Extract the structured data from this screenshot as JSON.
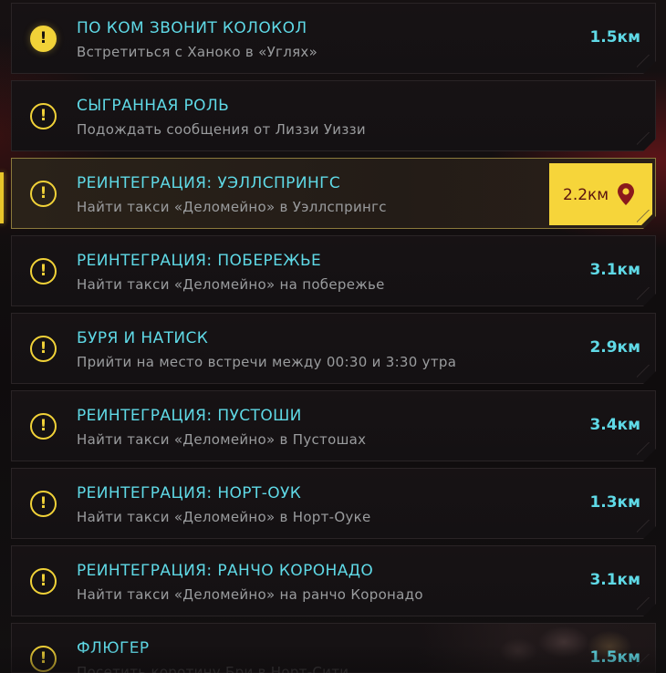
{
  "jobs": [
    {
      "title": "ПО КОМ ЗВОНИТ КОЛОКОЛ",
      "subtitle": "Встретиться с Ханоко в «Углях»",
      "distance": "1.5км",
      "icon": "exclamation-filled-icon"
    },
    {
      "title": "СЫГРАННАЯ РОЛЬ",
      "subtitle": "Подождать сообщения от Лиззи Уиззи",
      "distance": "",
      "icon": "exclamation-icon"
    },
    {
      "title": "РЕИНТЕГРАЦИЯ: УЭЛЛСПРИНГС",
      "subtitle": "Найти такси «Деломейно» в Уэллспрингс",
      "distance": "2.2км",
      "icon": "exclamation-icon",
      "selected": true,
      "tracked_icon": "map-pin-icon"
    },
    {
      "title": "РЕИНТЕГРАЦИЯ: ПОБЕРЕЖЬЕ",
      "subtitle": "Найти такси «Деломейно» на побережье",
      "distance": "3.1км",
      "icon": "exclamation-icon"
    },
    {
      "title": "БУРЯ И НАТИСК",
      "subtitle": "Прийти на место встречи между 00:30 и 3:30 утра",
      "distance": "2.9км",
      "icon": "exclamation-icon"
    },
    {
      "title": "РЕИНТЕГРАЦИЯ: ПУСТОШИ",
      "subtitle": "Найти такси «Деломейно» в Пустошах",
      "distance": "3.4км",
      "icon": "exclamation-icon"
    },
    {
      "title": "РЕИНТЕГРАЦИЯ: НОРТ-ОУК",
      "subtitle": "Найти такси «Деломейно» в Норт-Оуке",
      "distance": "1.3км",
      "icon": "exclamation-icon"
    },
    {
      "title": "РЕИНТЕГРАЦИЯ: РАНЧО КОРОНАДО",
      "subtitle": "Найти такси «Деломейно» на ранчо Коронадо",
      "distance": "3.1км",
      "icon": "exclamation-icon"
    },
    {
      "title": "ФЛЮГЕР",
      "subtitle": "Посетить коротину Бри в Норт-Сити",
      "distance": "1.5км",
      "icon": "exclamation-icon"
    }
  ],
  "colors": {
    "accent_cyan": "#5fd9e6",
    "accent_yellow": "#f6d53a",
    "pin_red": "#8a1a1c",
    "subtitle_grey": "#9a9c9e",
    "card_bg": "#161214"
  }
}
